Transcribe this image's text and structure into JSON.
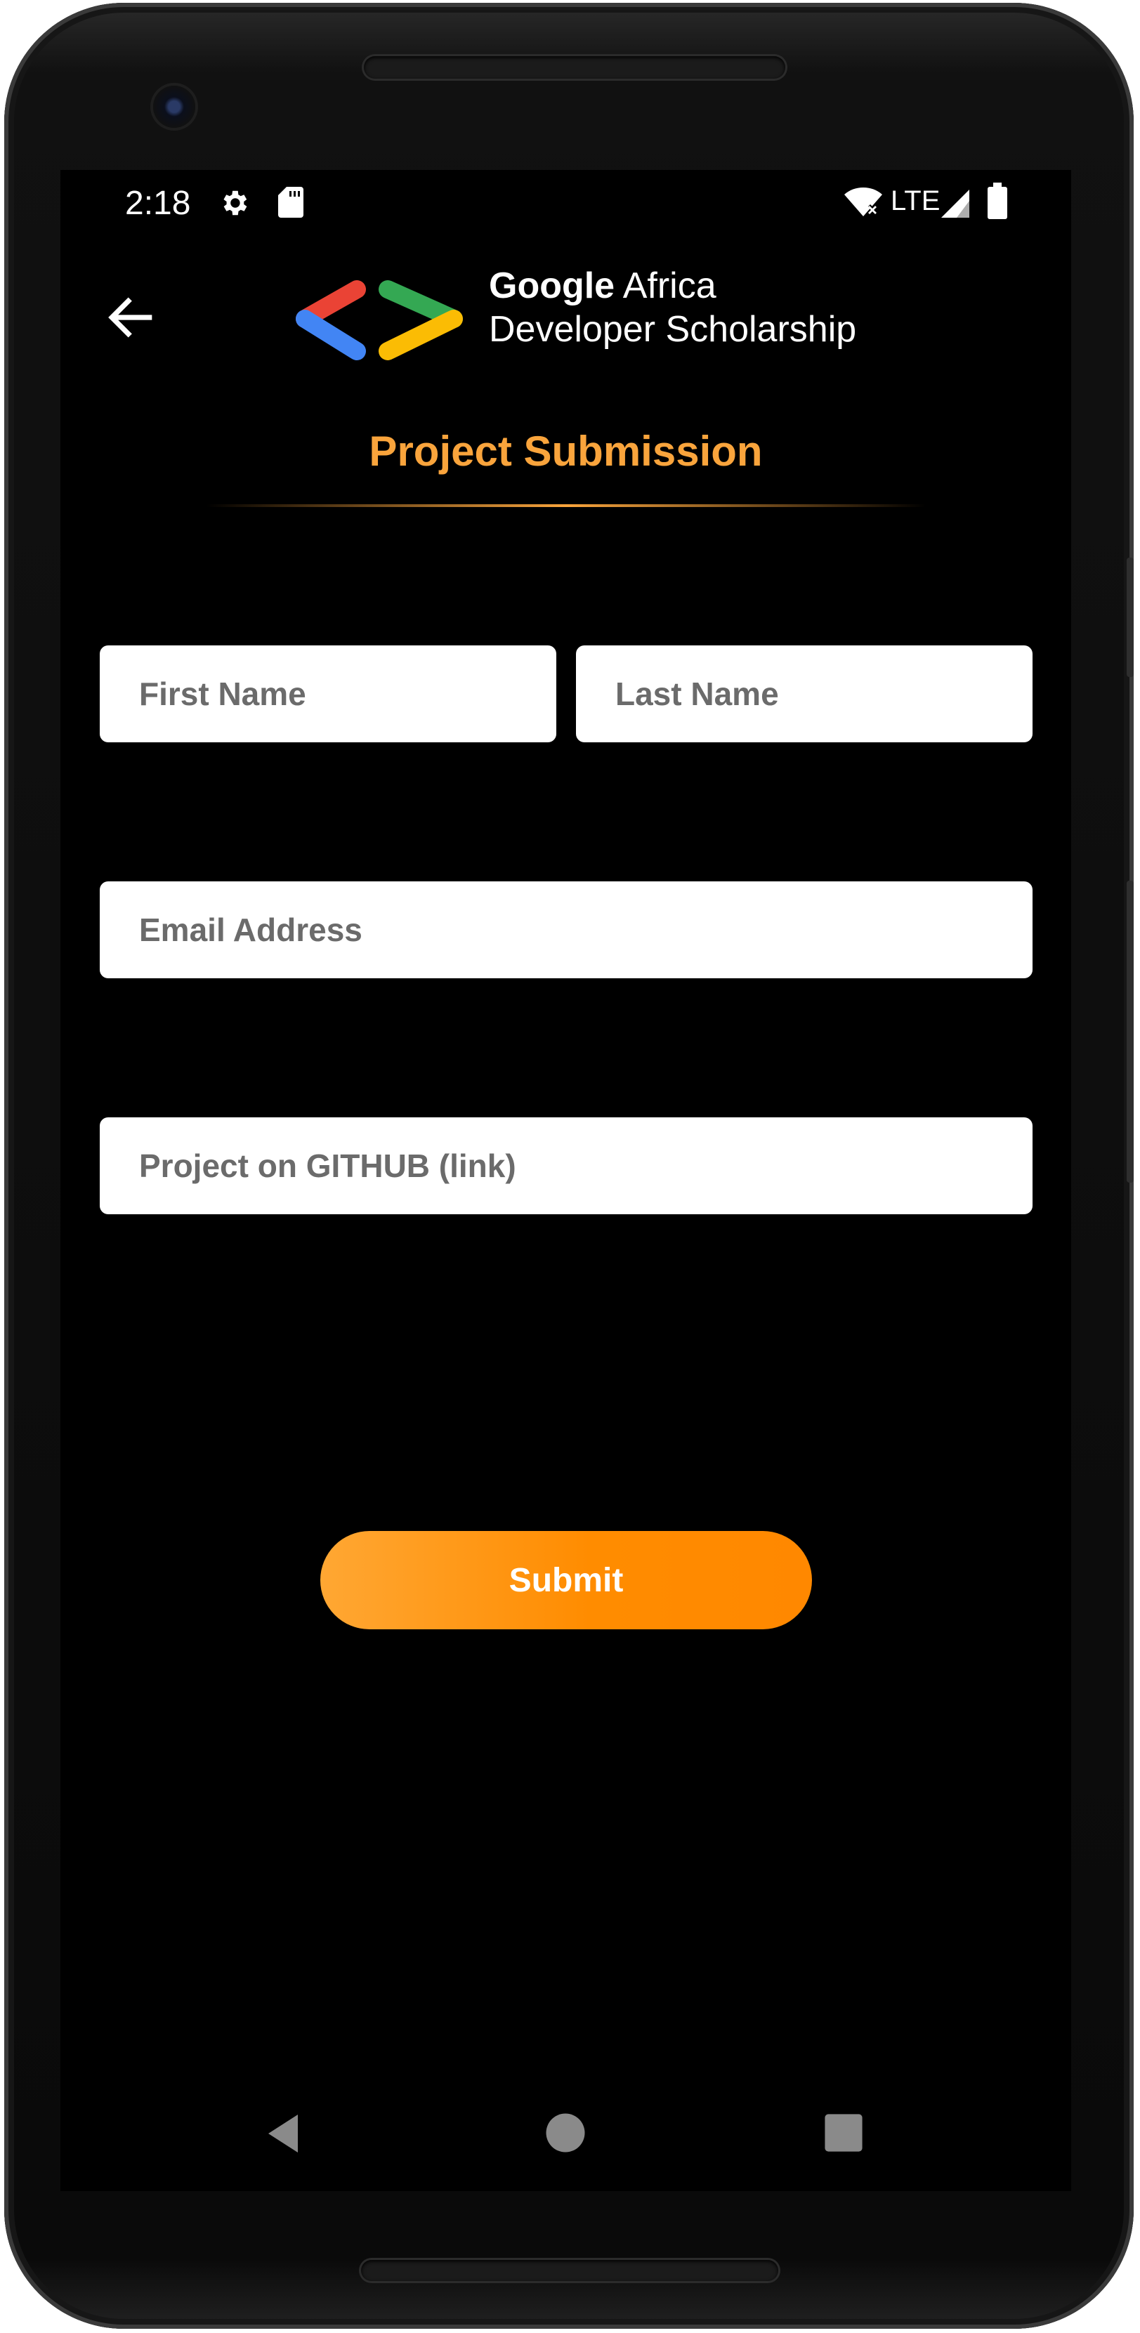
{
  "status_bar": {
    "time": "2:18",
    "icons": [
      "settings-gear-icon",
      "sd-card-icon",
      "wifi-icon",
      "signal-icon",
      "battery-icon"
    ],
    "network": "LTE"
  },
  "header": {
    "back_icon": "arrow-back-icon",
    "brand_line1_bold": "Google",
    "brand_line1_rest": " Africa",
    "brand_line2": "Developer Scholarship",
    "logo_colors": [
      "#EA4335",
      "#4285F4",
      "#34A853",
      "#FBBC04"
    ]
  },
  "page": {
    "title": "Project Submission",
    "accent_color": "#F9A43C"
  },
  "form": {
    "first_name": {
      "placeholder": "First Name",
      "value": ""
    },
    "last_name": {
      "placeholder": "Last Name",
      "value": ""
    },
    "email": {
      "placeholder": "Email Address",
      "value": ""
    },
    "github": {
      "placeholder": "Project on GITHUB (link)",
      "value": ""
    },
    "submit_label": "Submit"
  },
  "nav_bar": {
    "icons": [
      "back-triangle-icon",
      "home-circle-icon",
      "recents-square-icon"
    ]
  }
}
